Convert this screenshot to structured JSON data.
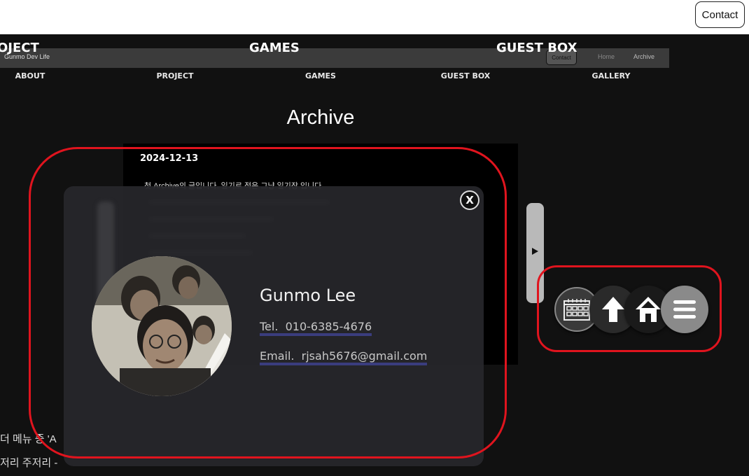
{
  "header": {
    "contact_label": "Contact"
  },
  "big_nav": {
    "items": [
      "OJECT",
      "GAMES",
      "GUEST BOX"
    ]
  },
  "mini_header": {
    "logo": "Gunmo Dev Life",
    "contact": "Contact",
    "home": "Home",
    "archive": "Archive"
  },
  "main_nav": {
    "items": [
      "ABOUT",
      "PROJECT",
      "GAMES",
      "GUEST BOX",
      "GALLERY"
    ]
  },
  "page": {
    "title": "Archive"
  },
  "entry": {
    "date": "2024-12-13",
    "text": "첫 Archive의 글입니다. 일기로 적은 그냥 일기장 입니다"
  },
  "modal": {
    "close_label": "X",
    "name": "Gunmo Lee",
    "tel_label": "Tel.",
    "tel": "010-6385-4676",
    "email_label": "Email.",
    "email": "rjsah5676@gmail.com"
  },
  "background_text": {
    "line1": "더 메뉴 중 'A",
    "line2": "저리 주저리 -"
  },
  "floating_buttons": [
    "calendar-icon",
    "arrow-up-icon",
    "home-icon",
    "menu-icon"
  ],
  "colors": {
    "highlight": "#e0141e",
    "link_underline": "#3a3d7e",
    "background": "#111111"
  }
}
